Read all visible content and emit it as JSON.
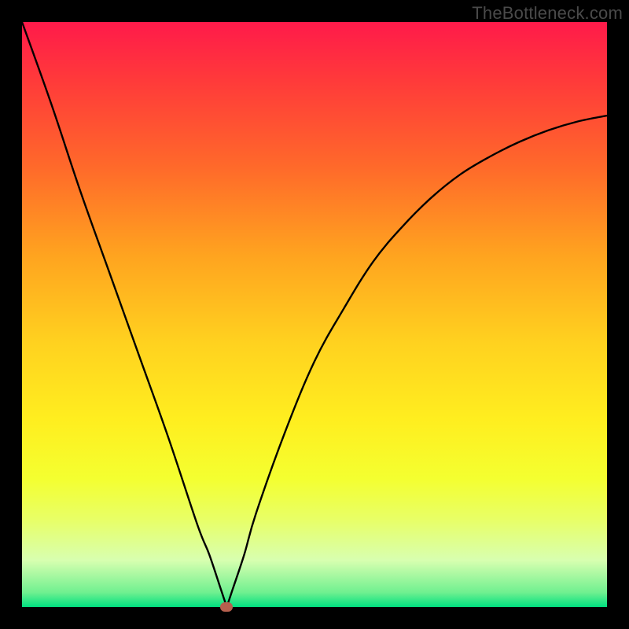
{
  "watermark": "TheBottleneck.com",
  "chart_data": {
    "type": "line",
    "title": "",
    "xlabel": "",
    "ylabel": "",
    "xlim": [
      0,
      100
    ],
    "ylim": [
      0,
      100
    ],
    "x": [
      0,
      5,
      10,
      15,
      20,
      25,
      30,
      32,
      34,
      35,
      36,
      38,
      40,
      45,
      50,
      55,
      60,
      65,
      70,
      75,
      80,
      85,
      90,
      95,
      100
    ],
    "y": [
      100,
      86,
      71,
      57,
      43,
      29,
      14,
      9,
      3,
      0,
      3,
      9,
      16,
      30,
      42,
      51,
      59,
      65,
      70,
      74,
      77,
      79.5,
      81.5,
      83,
      84
    ],
    "cusp_x": 35,
    "cusp_y": 0,
    "marker": {
      "x": 35,
      "y": 0
    }
  },
  "colors": {
    "curve": "#000000",
    "marker": "#b7604e"
  }
}
